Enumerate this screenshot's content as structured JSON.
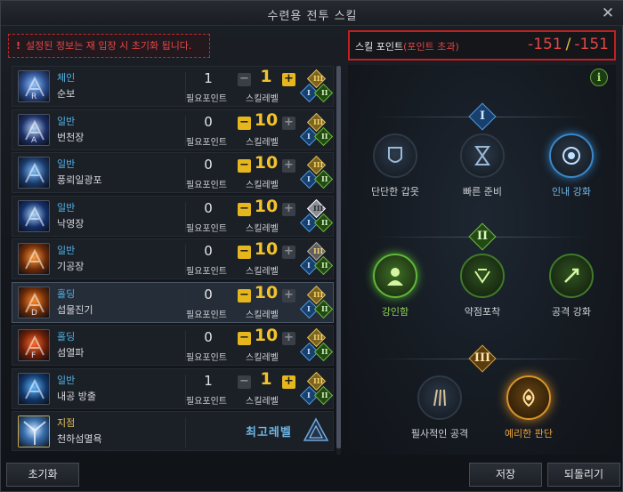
{
  "window": {
    "title": "수련용 전투 스킬",
    "close": "✕"
  },
  "notice": {
    "icon": "!",
    "text": "설정된 정보는 재 입장 시 초기화 됩니다."
  },
  "points": {
    "label": "스킬 포인트",
    "excess": "(포인트 초과)",
    "current": "-151",
    "slash": "/",
    "total": "-151"
  },
  "labels": {
    "required": "필요포인트",
    "skill_level": "스킬레벨",
    "minus": "−",
    "plus": "+"
  },
  "skills": [
    {
      "type": "체인",
      "name": "순보",
      "key": "R",
      "required": "1",
      "level": "1",
      "minus_active": false,
      "plus_active": true,
      "tripod_top": "III",
      "tripod_left": "I",
      "tripod_right": "II",
      "top_color": "gold",
      "icon": "dash-skill-icon"
    },
    {
      "type": "일반",
      "name": "번천장",
      "key": "A",
      "required": "0",
      "level": "10",
      "minus_active": true,
      "plus_active": false,
      "tripod_top": "III",
      "tripod_left": "I",
      "tripod_right": "II",
      "top_color": "gold",
      "icon": "palm-strike-skill-icon"
    },
    {
      "type": "일반",
      "name": "풍뢰일광포",
      "key": "",
      "required": "0",
      "level": "10",
      "minus_active": true,
      "plus_active": false,
      "tripod_top": "III",
      "tripod_left": "I",
      "tripod_right": "II",
      "top_color": "gold",
      "icon": "wind-thunder-skill-icon"
    },
    {
      "type": "일반",
      "name": "낙영장",
      "key": "",
      "required": "0",
      "level": "10",
      "minus_active": true,
      "plus_active": false,
      "tripod_top": "III",
      "tripod_left": "I",
      "tripod_right": "II",
      "top_color": "white",
      "icon": "falling-shadow-skill-icon"
    },
    {
      "type": "일반",
      "name": "기공장",
      "key": "",
      "required": "0",
      "level": "10",
      "minus_active": true,
      "plus_active": false,
      "tripod_top": "III",
      "tripod_left": "I",
      "tripod_right": "II",
      "top_color": "grey",
      "icon": "energy-palm-skill-icon"
    },
    {
      "type": "홀딩",
      "name": "섭물진기",
      "key": "D",
      "required": "0",
      "level": "10",
      "minus_active": true,
      "plus_active": false,
      "tripod_top": "III",
      "tripod_left": "I",
      "tripod_right": "II",
      "top_color": "gold",
      "icon": "absorb-energy-skill-icon"
    },
    {
      "type": "홀딩",
      "name": "섬열파",
      "key": "F",
      "required": "0",
      "level": "10",
      "minus_active": true,
      "plus_active": false,
      "tripod_top": "III",
      "tripod_left": "I",
      "tripod_right": "II",
      "top_color": "gold",
      "icon": "flash-wave-skill-icon"
    },
    {
      "type": "일반",
      "name": "내공 방출",
      "key": "",
      "required": "1",
      "level": "1",
      "minus_active": false,
      "plus_active": true,
      "tripod_top": "III",
      "tripod_left": "I",
      "tripod_right": "II",
      "top_color": "gold",
      "icon": "inner-release-skill-icon"
    }
  ],
  "special_skill": {
    "type": "지점",
    "name": "천하섬멸욕",
    "max_label": "최고레벨",
    "icon": "awakening-skill-icon"
  },
  "tripods": {
    "tier1": {
      "numeral": "I",
      "nodes": [
        {
          "label": "단단한 갑옷",
          "icon": "armor-icon",
          "state": "inactive"
        },
        {
          "label": "빠른 준비",
          "icon": "hourglass-icon",
          "state": "inactive"
        },
        {
          "label": "인내 강화",
          "icon": "endurance-icon",
          "state": "active-blue"
        }
      ]
    },
    "tier2": {
      "numeral": "II",
      "nodes": [
        {
          "label": "강인함",
          "icon": "toughness-icon",
          "state": "active-green"
        },
        {
          "label": "약점포착",
          "icon": "weakness-icon",
          "state": "green-dim"
        },
        {
          "label": "공격 강화",
          "icon": "attack-boost-icon",
          "state": "green-dim"
        }
      ]
    },
    "tier3": {
      "numeral": "III",
      "nodes": [
        {
          "label": "필사적인 공격",
          "icon": "desperate-attack-icon",
          "state": "inactive"
        },
        {
          "label": "예리한 판단",
          "icon": "sharp-judgment-icon",
          "state": "active-gold"
        }
      ]
    }
  },
  "info": "i",
  "buttons": {
    "reset": "초기화",
    "save": "저장",
    "revert": "되돌리기"
  }
}
